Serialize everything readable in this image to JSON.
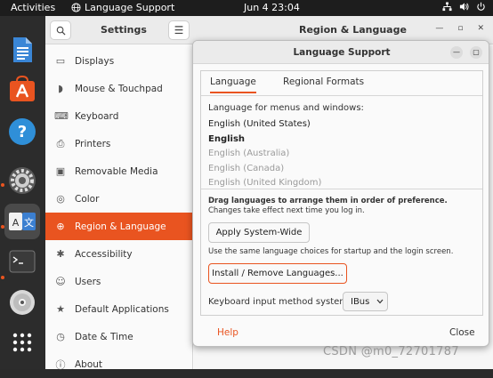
{
  "topbar": {
    "activities": "Activities",
    "input_source": "Language Support",
    "clock": "Jun 4  23:04",
    "tray_icons": [
      "network-icon",
      "volume-icon",
      "power-icon"
    ]
  },
  "dock": {
    "items": [
      "text-editor-icon",
      "software-store-icon",
      "help-icon",
      "settings-gear-icon",
      "language-support-icon",
      "terminal-icon",
      "disc-icon",
      "app-grid-icon"
    ]
  },
  "settings": {
    "title": "Settings",
    "pane_title": "Region & Language",
    "sidebar": [
      {
        "label": "Displays",
        "icon": "display-icon"
      },
      {
        "label": "Mouse & Touchpad",
        "icon": "mouse-icon"
      },
      {
        "label": "Keyboard",
        "icon": "keyboard-icon"
      },
      {
        "label": "Printers",
        "icon": "printer-icon"
      },
      {
        "label": "Removable Media",
        "icon": "media-icon"
      },
      {
        "label": "Color",
        "icon": "color-icon"
      },
      {
        "label": "Region & Language",
        "icon": "globe-icon",
        "selected": true
      },
      {
        "label": "Accessibility",
        "icon": "accessibility-icon"
      },
      {
        "label": "Users",
        "icon": "users-icon"
      },
      {
        "label": "Default Applications",
        "icon": "star-icon"
      },
      {
        "label": "Date & Time",
        "icon": "clock-icon"
      },
      {
        "label": "About",
        "icon": "info-icon"
      }
    ]
  },
  "dialog": {
    "title": "Language Support",
    "tabs": [
      "Language",
      "Regional Formats"
    ],
    "menus_label": "Language for menus and windows:",
    "languages": [
      {
        "name": "English (United States)",
        "style": "normal"
      },
      {
        "name": "English",
        "style": "bold"
      },
      {
        "name": "English (Australia)",
        "style": "dim"
      },
      {
        "name": "English (Canada)",
        "style": "dim"
      },
      {
        "name": "English (United Kingdom)",
        "style": "dim"
      }
    ],
    "drag_hint": "Drag languages to arrange them in order of preference.",
    "drag_hint_sub": "Changes take effect next time you log in.",
    "apply_button": "Apply System-Wide",
    "same_choices": "Use the same language choices for startup and the login screen.",
    "install_button": "Install / Remove Languages...",
    "keyboard_label": "Keyboard input method system:",
    "keyboard_value": "IBus",
    "help": "Help",
    "close": "Close"
  },
  "watermark": "CSDN @m0_72701787",
  "colors": {
    "accent": "#e95420",
    "dock": "#2c2c2c",
    "topbar": "#1d1d1d"
  }
}
